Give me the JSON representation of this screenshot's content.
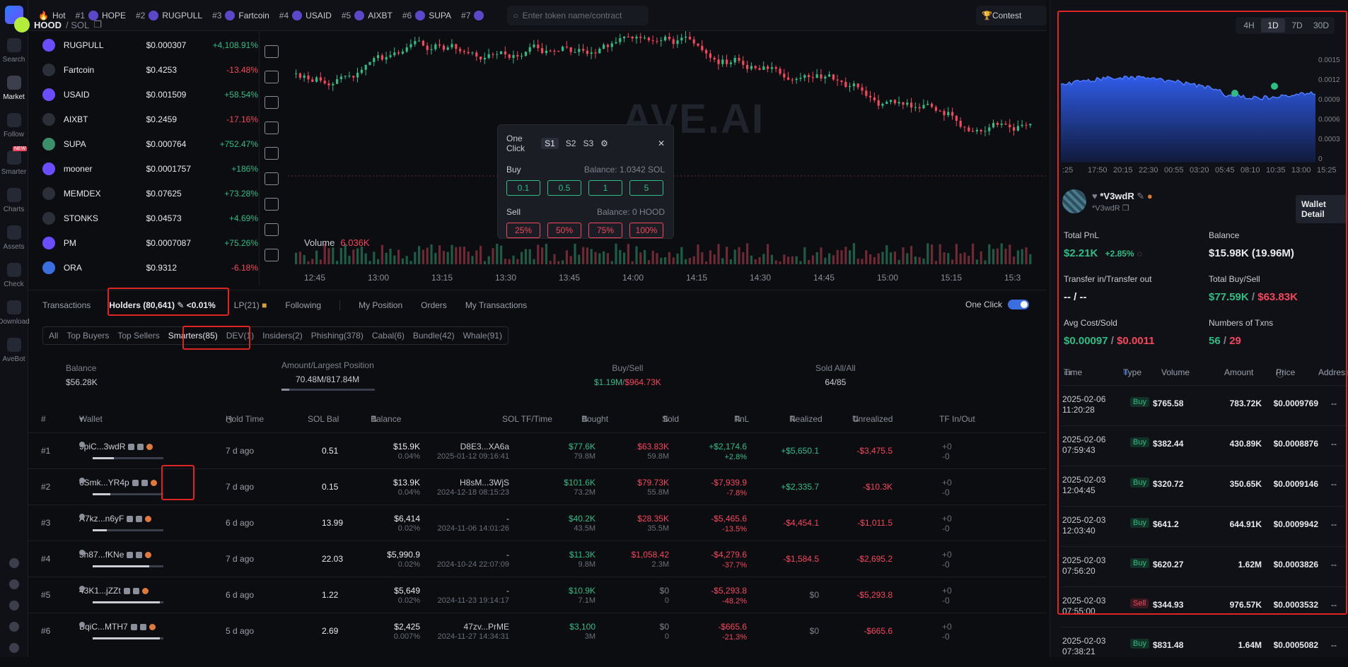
{
  "nav": [
    {
      "label": "Search"
    },
    {
      "label": "Market"
    },
    {
      "label": "Follow"
    },
    {
      "label": "Smarter"
    },
    {
      "label": "Charts"
    },
    {
      "label": "Assets"
    },
    {
      "label": "Check"
    },
    {
      "label": "Download"
    },
    {
      "label": "AveBot"
    }
  ],
  "nav_badge": "NEW",
  "topbar": {
    "hot": "Hot",
    "items": [
      {
        "rank": "#1",
        "name": "HOPE"
      },
      {
        "rank": "#2",
        "name": "RUGPULL"
      },
      {
        "rank": "#3",
        "name": "Fartcoin"
      },
      {
        "rank": "#4",
        "name": "USAID"
      },
      {
        "rank": "#5",
        "name": "AIXBT"
      },
      {
        "rank": "#6",
        "name": "SUPA"
      },
      {
        "rank": "#7",
        "name": ""
      }
    ],
    "search_placeholder": "Enter token name/contract",
    "contest": "Contest"
  },
  "tokens": [
    {
      "name": "RUGPULL",
      "price": "$0.000307",
      "change": "+4,108.91%",
      "up": true
    },
    {
      "name": "Fartcoin",
      "price": "$0.4253",
      "change": "-13.48%",
      "up": false
    },
    {
      "name": "USAID",
      "price": "$0.001509",
      "change": "+58.54%",
      "up": true
    },
    {
      "name": "AIXBT",
      "price": "$0.2459",
      "change": "-17.16%",
      "up": false
    },
    {
      "name": "SUPA",
      "price": "$0.000764",
      "change": "+752.47%",
      "up": true
    },
    {
      "name": "mooner",
      "price": "$0.0001757",
      "change": "+186%",
      "up": true
    },
    {
      "name": "MEMDEX",
      "price": "$0.07625",
      "change": "+73.28%",
      "up": true
    },
    {
      "name": "STONKS",
      "price": "$0.04573",
      "change": "+4.69%",
      "up": true
    },
    {
      "name": "PM",
      "price": "$0.0007087",
      "change": "+75.26%",
      "up": true
    },
    {
      "name": "ORA",
      "price": "$0.9312",
      "change": "-6.18%",
      "up": false
    }
  ],
  "chart": {
    "watermark": "AVE.AI",
    "volume_label": "Volume",
    "volume_value": "6.036K",
    "time_ticks": [
      "12:45",
      "13:00",
      "13:15",
      "13:30",
      "13:45",
      "14:00",
      "14:15",
      "14:30",
      "14:45",
      "15:00",
      "15:15",
      "15:3"
    ]
  },
  "oneclick": {
    "title": "One Click",
    "slots": [
      "S1",
      "S2",
      "S3"
    ],
    "buy_label": "Buy",
    "buy_balance": "Balance: 1.0342 SOL",
    "buy_amounts": [
      "0.1",
      "0.5",
      "1",
      "5"
    ],
    "sell_label": "Sell",
    "sell_balance": "Balance: 0 HOOD",
    "sell_amounts": [
      "25%",
      "50%",
      "75%",
      "100%"
    ]
  },
  "tabs": {
    "transactions": "Transactions",
    "holders": "Holders (80,641)",
    "holders_pct": "<0.01%",
    "lp": "LP(21)",
    "following": "Following",
    "my_position": "My Position",
    "orders": "Orders",
    "my_transactions": "My Transactions",
    "one_click": "One Click"
  },
  "filters": [
    "All",
    "Top Buyers",
    "Top Sellers",
    "Smarters(85)",
    "DEV(1)",
    "Insiders(2)",
    "Phishing(378)",
    "Cabal(6)",
    "Bundle(42)",
    "Whale(91)"
  ],
  "summary": {
    "balance_label": "Balance",
    "balance_value": "$56.28K",
    "amount_label": "Amount/Largest Position",
    "amount_value": "70.48M/817.84M",
    "amount_fraction": 0.086,
    "buysell_label": "Buy/Sell",
    "buy_value": "$1.19M",
    "sell_value": "$964.73K",
    "sold_label": "Sold All/All",
    "sold_value": "64/85"
  },
  "table_headers": {
    "num": "#",
    "wallet": "Wallet",
    "hold": "Hold Time",
    "sol": "SOL Bal",
    "balance": "Balance",
    "tf": "SOL TF/Time",
    "bought": "Bought",
    "sold": "Sold",
    "pnl": "PnL",
    "realized": "Realized",
    "unrealized": "Unrealized",
    "tfio": "TF In/Out"
  },
  "holders": [
    {
      "rank": "#1",
      "wallet": "9piC...3wdR",
      "hold": "7 d ago",
      "sol": "0.51",
      "bal": "$15.9K",
      "balpct": "0.04%",
      "tf": "D8E3...XA6a",
      "tftime": "2025-01-12 09:16:41",
      "bought": "$77.6K",
      "boughtq": "79.8M",
      "sold": "$63.83K",
      "soldq": "59.8M",
      "pnl": "+$2,174.6",
      "pnlpct": "+2.8%",
      "pnlup": true,
      "real": "+$5,650.1",
      "realup": true,
      "unreal": "-$3,475.5",
      "tfin": "+0",
      "tfout": "-0",
      "wfill": 0.3
    },
    {
      "rank": "#2",
      "wallet": "6Smk...YR4p",
      "hold": "7 d ago",
      "sol": "0.15",
      "bal": "$13.9K",
      "balpct": "0.04%",
      "tf": "H8sM...3WjS",
      "tftime": "2024-12-18 08:15:23",
      "bought": "$101.6K",
      "boughtq": "73.2M",
      "sold": "$79.73K",
      "soldq": "55.8M",
      "pnl": "-$7,939.9",
      "pnlpct": "-7.8%",
      "pnlup": false,
      "real": "+$2,335.7",
      "realup": true,
      "unreal": "-$10.3K",
      "tfin": "+0",
      "tfout": "-0",
      "wfill": 0.25
    },
    {
      "rank": "#3",
      "wallet": "A7kz...n6yF",
      "hold": "6 d ago",
      "sol": "13.99",
      "bal": "$6,414",
      "balpct": "0.02%",
      "tf": "-",
      "tftime": "2024-11-06 14:01:26",
      "bought": "$40.2K",
      "boughtq": "43.5M",
      "sold": "$28.35K",
      "soldq": "35.5M",
      "pnl": "-$5,465.6",
      "pnlpct": "-13.5%",
      "pnlup": false,
      "real": "-$4,454.1",
      "realup": false,
      "unreal": "-$1,011.5",
      "tfin": "+0",
      "tfout": "-0",
      "wfill": 0.2
    },
    {
      "rank": "#4",
      "wallet": "5h87...fKNe",
      "hold": "7 d ago",
      "sol": "22.03",
      "bal": "$5,990.9",
      "balpct": "0.02%",
      "tf": "-",
      "tftime": "2024-10-24 22:07:09",
      "bought": "$11.3K",
      "boughtq": "9.8M",
      "sold": "$1,058.42",
      "soldq": "2.3M",
      "pnl": "-$4,279.6",
      "pnlpct": "-37.7%",
      "pnlup": false,
      "real": "-$1,584.5",
      "realup": false,
      "unreal": "-$2,695.2",
      "tfin": "+0",
      "tfout": "-0",
      "wfill": 0.8
    },
    {
      "rank": "#5",
      "wallet": "43K1...jZZt",
      "hold": "6 d ago",
      "sol": "1.22",
      "bal": "$5,649",
      "balpct": "0.02%",
      "tf": "-",
      "tftime": "2024-11-23 19:14:17",
      "bought": "$10.9K",
      "boughtq": "7.1M",
      "sold": "$0",
      "soldq": "0",
      "pnl": "-$5,293.8",
      "pnlpct": "-48.2%",
      "pnlup": false,
      "real": "$0",
      "realup": null,
      "unreal": "-$5,293.8",
      "tfin": "+0",
      "tfout": "-0",
      "wfill": 0.95
    },
    {
      "rank": "#6",
      "wallet": "BqiC...MTH7",
      "hold": "5 d ago",
      "sol": "2.69",
      "bal": "$2,425",
      "balpct": "0.007%",
      "tf": "47zv...PrME",
      "tftime": "2024-11-27 14:34:31",
      "bought": "$3,100",
      "boughtq": "3M",
      "sold": "$0",
      "soldq": "0",
      "pnl": "-$665.6",
      "pnlpct": "-21.3%",
      "pnlup": false,
      "real": "$0",
      "realup": null,
      "unreal": "-$665.6",
      "tfin": "+0",
      "tfout": "-0",
      "wfill": 0.95
    }
  ],
  "right": {
    "symbol": "HOOD",
    "pair": "/ SOL",
    "timeframes": [
      "4H",
      "1D",
      "7D",
      "30D"
    ],
    "y_ticks": [
      "0.0015",
      "0.0012",
      "0.0009",
      "0.0006",
      "0.0003",
      "0"
    ],
    "x_ticks": [
      ":25",
      "17:50",
      "20:15",
      "22:30",
      "00:55",
      "03:20",
      "05:45",
      "08:10",
      "10:35",
      "13:00",
      "15:25"
    ],
    "wallet_name": "*V3wdR",
    "wallet_addr": "*V3wdR",
    "wallet_detail": "Wallet Detail",
    "total_pnl_label": "Total PnL",
    "total_pnl": "$2.21K",
    "total_pnl_pct": "+2.85%",
    "balance_label": "Balance",
    "balance": "$15.98K (19.96M)",
    "transfer_label": "Transfer in/Transfer out",
    "transfer": "-- / --",
    "total_bs_label": "Total Buy/Sell",
    "total_buy": "$77.59K",
    "total_sell": "$63.83K",
    "avg_label": "Avg Cost/Sold",
    "avg_cost": "$0.00097",
    "avg_sold": "$0.0011",
    "txns_label": "Numbers of Txns",
    "txns_buy": "56",
    "txns_sell": "29",
    "headers": {
      "time": "Time",
      "type": "Type",
      "volume": "Volume",
      "amount": "Amount",
      "price": "Price",
      "address": "Address"
    },
    "txns": [
      {
        "date": "2025-02-06",
        "time": "11:20:28",
        "type": "Buy",
        "volume": "$765.58",
        "amount": "783.72K",
        "price": "$0.0009769",
        "addr": "--"
      },
      {
        "date": "2025-02-06",
        "time": "07:59:43",
        "type": "Buy",
        "volume": "$382.44",
        "amount": "430.89K",
        "price": "$0.0008876",
        "addr": "--"
      },
      {
        "date": "2025-02-03",
        "time": "12:04:45",
        "type": "Buy",
        "volume": "$320.72",
        "amount": "350.65K",
        "price": "$0.0009146",
        "addr": "--"
      },
      {
        "date": "2025-02-03",
        "time": "12:03:40",
        "type": "Buy",
        "volume": "$641.2",
        "amount": "644.91K",
        "price": "$0.0009942",
        "addr": "--"
      },
      {
        "date": "2025-02-03",
        "time": "07:56:20",
        "type": "Buy",
        "volume": "$620.27",
        "amount": "1.62M",
        "price": "$0.0003826",
        "addr": "--"
      },
      {
        "date": "2025-02-03",
        "time": "07:55:00",
        "type": "Sell",
        "volume": "$344.93",
        "amount": "976.57K",
        "price": "$0.0003532",
        "addr": "--"
      },
      {
        "date": "2025-02-03",
        "time": "07:38:21",
        "type": "Buy",
        "volume": "$831.48",
        "amount": "1.64M",
        "price": "$0.0005082",
        "addr": "--"
      }
    ]
  }
}
